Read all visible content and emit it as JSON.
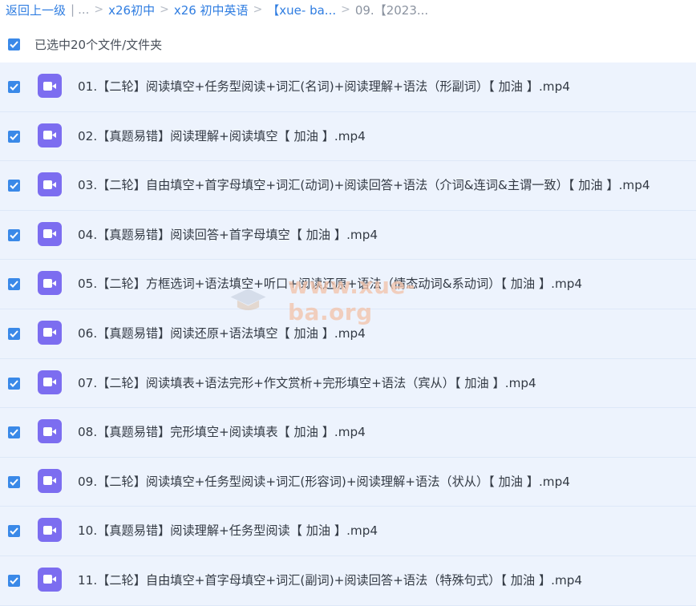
{
  "breadcrumb": {
    "back": "返回上一级",
    "divider": "|",
    "ellipsis": "...",
    "sep": ">",
    "items": [
      "x26初中",
      "x26 初中英语",
      "【xue- ba...",
      "09.【2023..."
    ]
  },
  "selection": {
    "text": "已选中20个文件/文件夹",
    "checked": true
  },
  "files": [
    {
      "name": "01.【二轮】阅读填空+任务型阅读+词汇(名词)+阅读理解+语法（形副词）【 加油 】.mp4",
      "checked": true
    },
    {
      "name": "02.【真题易错】阅读理解+阅读填空【 加油 】.mp4",
      "checked": true
    },
    {
      "name": "03.【二轮】自由填空+首字母填空+词汇(动词)+阅读回答+语法（介词&连词&主谓一致）【 加油 】.mp4",
      "checked": true
    },
    {
      "name": "04.【真题易错】阅读回答+首字母填空【 加油 】.mp4",
      "checked": true
    },
    {
      "name": "05.【二轮】方框选词+语法填空+听口+阅读还原+语法（情态动词&系动词）【 加油 】.mp4",
      "checked": true
    },
    {
      "name": "06.【真题易错】阅读还原+语法填空【 加油 】.mp4",
      "checked": true
    },
    {
      "name": "07.【二轮】阅读填表+语法完形+作文赏析+完形填空+语法（宾从）【 加油 】.mp4",
      "checked": true
    },
    {
      "name": "08.【真题易错】完形填空+阅读填表【 加油 】.mp4",
      "checked": true
    },
    {
      "name": "09.【二轮】阅读填空+任务型阅读+词汇(形容词)+阅读理解+语法（状从）【 加油 】.mp4",
      "checked": true
    },
    {
      "name": "10.【真题易错】阅读理解+任务型阅读【 加油 】.mp4",
      "checked": true
    },
    {
      "name": "11.【二轮】自由填空+首字母填空+词汇(副词)+阅读回答+语法（特殊句式）【 加油 】.mp4",
      "checked": true
    }
  ],
  "file_icon": "video-file-icon",
  "watermark": "www.xue-ba.org",
  "colors": {
    "accent": "#3a89e8",
    "row_bg": "#edf3fd",
    "video_icon": "#7c6df0"
  }
}
